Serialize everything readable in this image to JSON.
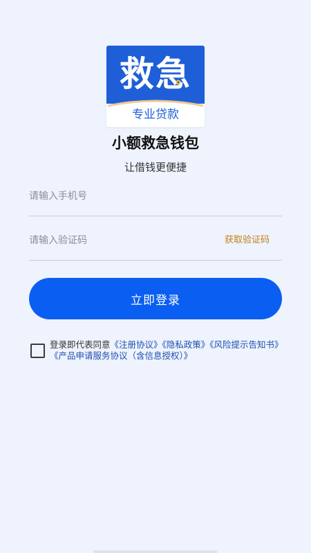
{
  "logo": {
    "main_text": "救急",
    "sub_text": "专业贷款"
  },
  "header": {
    "app_name": "小额救急钱包",
    "slogan": "让借钱更便捷"
  },
  "form": {
    "phone_placeholder": "请输入手机号",
    "code_placeholder": "请输入验证码",
    "get_code_label": "获取验证码",
    "login_label": "立即登录"
  },
  "agreement": {
    "prefix": "登录即代表同意",
    "links": [
      "《注册协议》",
      "《隐私政策》",
      "《风险提示告知书》",
      "《产品申请服务协议（含信息授权）》"
    ],
    "checked": false
  },
  "colors": {
    "background": "#eef3fd",
    "brand_blue": "#1e5fd8",
    "button_blue": "#0a5ff2",
    "get_code": "#c0801a",
    "link": "#1d4fb0"
  }
}
